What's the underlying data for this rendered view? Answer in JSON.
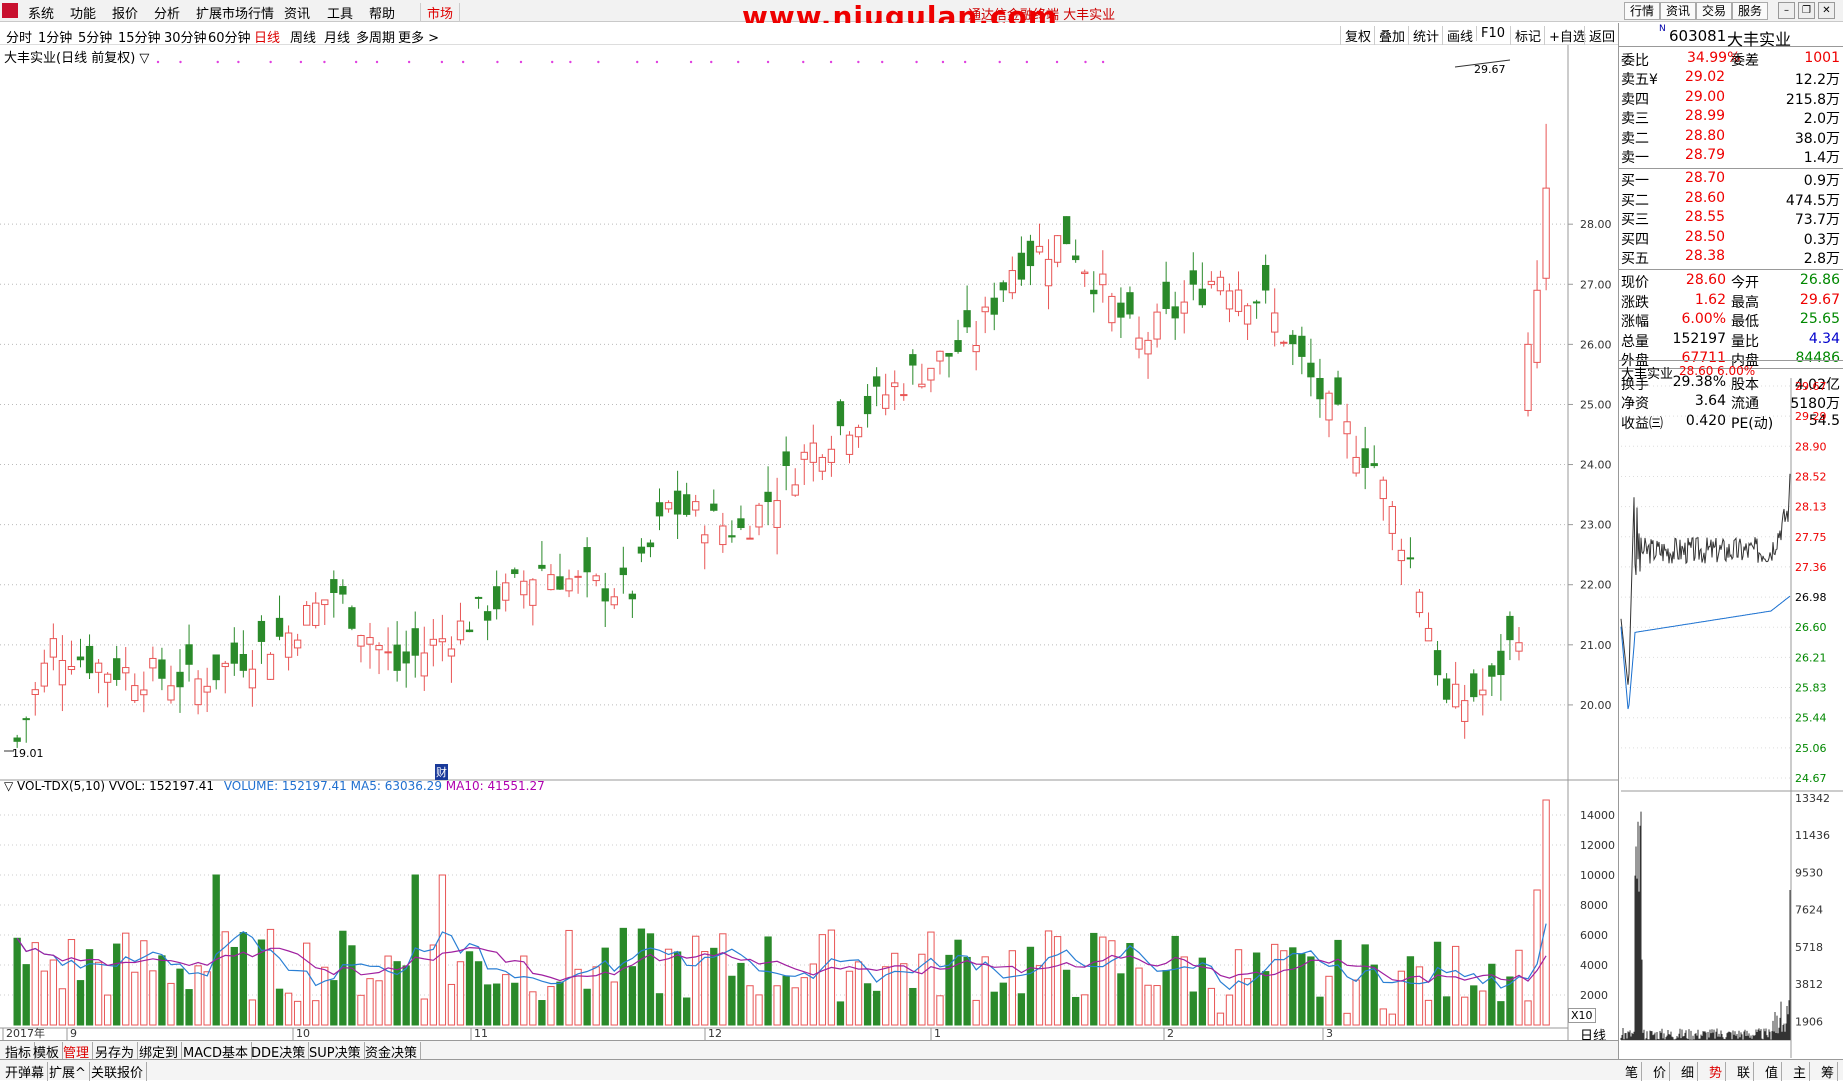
{
  "menubar": {
    "items": [
      "系统",
      "功能",
      "报价",
      "分析",
      "扩展市场行情",
      "资讯",
      "工具",
      "帮助"
    ],
    "market": "市场",
    "watermark": "www.niugulan.com",
    "title_overlay": "通达信金融终端 大丰实业",
    "right_buttons": [
      "行情",
      "资讯",
      "交易",
      "服务"
    ]
  },
  "periodbar": {
    "periods": [
      "分时",
      "1分钟",
      "5分钟",
      "15分钟",
      "30分钟",
      "60分钟",
      "日线",
      "周线",
      "月线",
      "多周期",
      "更多 >"
    ],
    "selected": "日线",
    "tools": [
      "复权",
      "叠加",
      "统计",
      "画线",
      "F10",
      "标记",
      "+自选",
      "返回"
    ]
  },
  "chart": {
    "title": "大丰实业(日线 前复权) ▽",
    "high_label": "29.67",
    "low_label": "19.01",
    "x_labels": [
      "2017年",
      "9",
      "10",
      "11",
      "12",
      "1",
      "2",
      "3"
    ],
    "y_ticks": [
      "28.00",
      "27.00",
      "26.00",
      "25.00",
      "24.00",
      "23.00",
      "22.00",
      "21.00",
      "20.00"
    ],
    "vol_header": {
      "name": "▽ VOL-TDX(5,10)",
      "vvol": "VVOL: 152197.41",
      "volume": "VOLUME: 152197.41",
      "ma5": "MA5: 63036.29",
      "ma10": "MA10: 41551.27"
    },
    "vol_ticks": [
      "14000",
      "12000",
      "10000",
      "8000",
      "6000",
      "4000",
      "2000"
    ],
    "vol_unit": "X10",
    "period_tag": "日线",
    "marker": "财"
  },
  "chart_data": {
    "type": "candlestick",
    "series_seed": "daily",
    "price_range": [
      19.0,
      29.9
    ],
    "last_close": 28.6,
    "high": 29.67,
    "low": 19.01
  },
  "quote": {
    "code": "603081",
    "name": "大丰实业",
    "weibi_label": "委比",
    "weibi": "34.99%",
    "weicha_label": "委差",
    "weicha": "1001",
    "asks": [
      {
        "label": "卖五",
        "price": "29.02",
        "vol": "12.2万",
        "mark": "¥"
      },
      {
        "label": "卖四",
        "price": "29.00",
        "vol": "215.8万"
      },
      {
        "label": "卖三",
        "price": "28.99",
        "vol": "2.0万"
      },
      {
        "label": "卖二",
        "price": "28.80",
        "vol": "38.0万"
      },
      {
        "label": "卖一",
        "price": "28.79",
        "vol": "1.4万"
      }
    ],
    "bids": [
      {
        "label": "买一",
        "price": "28.70",
        "vol": "0.9万"
      },
      {
        "label": "买二",
        "price": "28.60",
        "vol": "474.5万"
      },
      {
        "label": "买三",
        "price": "28.55",
        "vol": "73.7万"
      },
      {
        "label": "买四",
        "price": "28.50",
        "vol": "0.3万"
      },
      {
        "label": "买五",
        "price": "28.38",
        "vol": "2.8万"
      }
    ],
    "stats": [
      [
        "现价",
        "28.60",
        "今开",
        "26.86"
      ],
      [
        "涨跌",
        "1.62",
        "最高",
        "29.67"
      ],
      [
        "涨幅",
        "6.00%",
        "最低",
        "25.65"
      ],
      [
        "总量",
        "152197",
        "量比",
        "4.34"
      ],
      [
        "外盘",
        "67711",
        "内盘",
        "84486"
      ],
      [
        "换手",
        "29.38%",
        "股本",
        "4.02亿"
      ],
      [
        "净资",
        "3.64",
        "流通",
        "5180万"
      ],
      [
        "收益㈢",
        "0.420",
        "PE(动)",
        "54.5"
      ]
    ]
  },
  "mini": {
    "name": "大丰实业",
    "price": "28.60",
    "pct": "6.00%",
    "ticks": [
      "29.67",
      "29.29",
      "28.90",
      "28.52",
      "28.13",
      "27.75",
      "27.36",
      "26.98",
      "26.60",
      "26.21",
      "25.83",
      "25.44",
      "25.06",
      "24.67"
    ],
    "vol_ticks": [
      "13342",
      "11436",
      "9530",
      "7624",
      "5718",
      "3812",
      "1906"
    ]
  },
  "bottomtabs": [
    "指标",
    "模板",
    "管理",
    "另存为",
    "绑定到",
    "MACD基本",
    "DDE决策",
    "SUP决策",
    "资金决策"
  ],
  "statusbar": [
    "开弹幕",
    "扩展^",
    "关联报价"
  ],
  "rightbottom": [
    "笔",
    "价",
    "细",
    "势",
    "联",
    "值",
    "主",
    "筹"
  ]
}
